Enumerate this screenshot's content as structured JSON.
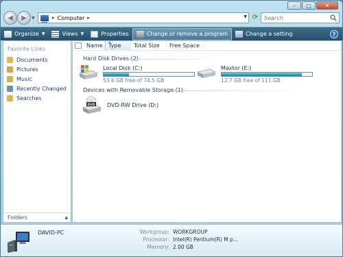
{
  "window": {
    "caption_buttons": [
      "minimize",
      "maximize",
      "close"
    ]
  },
  "address": {
    "location": "Computer",
    "search_placeholder": "Search"
  },
  "toolbar": {
    "organize": "Organize",
    "views": "Views",
    "properties": "Properties",
    "change_remove": "Change or remove a program",
    "change_setting": "Change a setting",
    "help": "?"
  },
  "nav": {
    "title": "Favorite Links",
    "items": [
      {
        "label": "Documents",
        "icon": "documents-icon",
        "color": "#e2b84a"
      },
      {
        "label": "Pictures",
        "icon": "pictures-icon",
        "color": "#d8a64a"
      },
      {
        "label": "Music",
        "icon": "music-icon",
        "color": "#d9b04c"
      },
      {
        "label": "Recently Changed",
        "icon": "recently-changed-icon",
        "color": "#6d8fb8"
      },
      {
        "label": "Searches",
        "icon": "searches-icon",
        "color": "#e0b44e"
      }
    ],
    "folders": "Folders"
  },
  "columns": [
    "Name",
    "Type",
    "Total Size",
    "Free Space"
  ],
  "groups": {
    "hdd": "Hard Disk Drives (2)",
    "removable": "Devices with Removable Storage (1)"
  },
  "drives": [
    {
      "name": "Local Disk (C:)",
      "free_text": "53.6 GB free of 74.5 GB",
      "used_fraction": 0.28
    },
    {
      "name": "Maxtor (E:)",
      "free_text": "12.7 GB free of 111 GB",
      "used_fraction": 0.89
    }
  ],
  "removable": [
    {
      "name": "DVD-RW Drive (D:)",
      "badge": "DVD"
    }
  ],
  "details": {
    "computer_name": "DAVID-PC",
    "workgroup_label": "Workgroup:",
    "workgroup_value": "WORKGROUP",
    "processor_label": "Processor:",
    "processor_value": "Intel(R) Pentium(R) M p...",
    "memory_label": "Memory:",
    "memory_value": "2.00 GB"
  },
  "colors": {
    "toolbar": "#2f5c78",
    "link": "#1e3a8a",
    "capacity_fill": "#2a9dc4"
  }
}
